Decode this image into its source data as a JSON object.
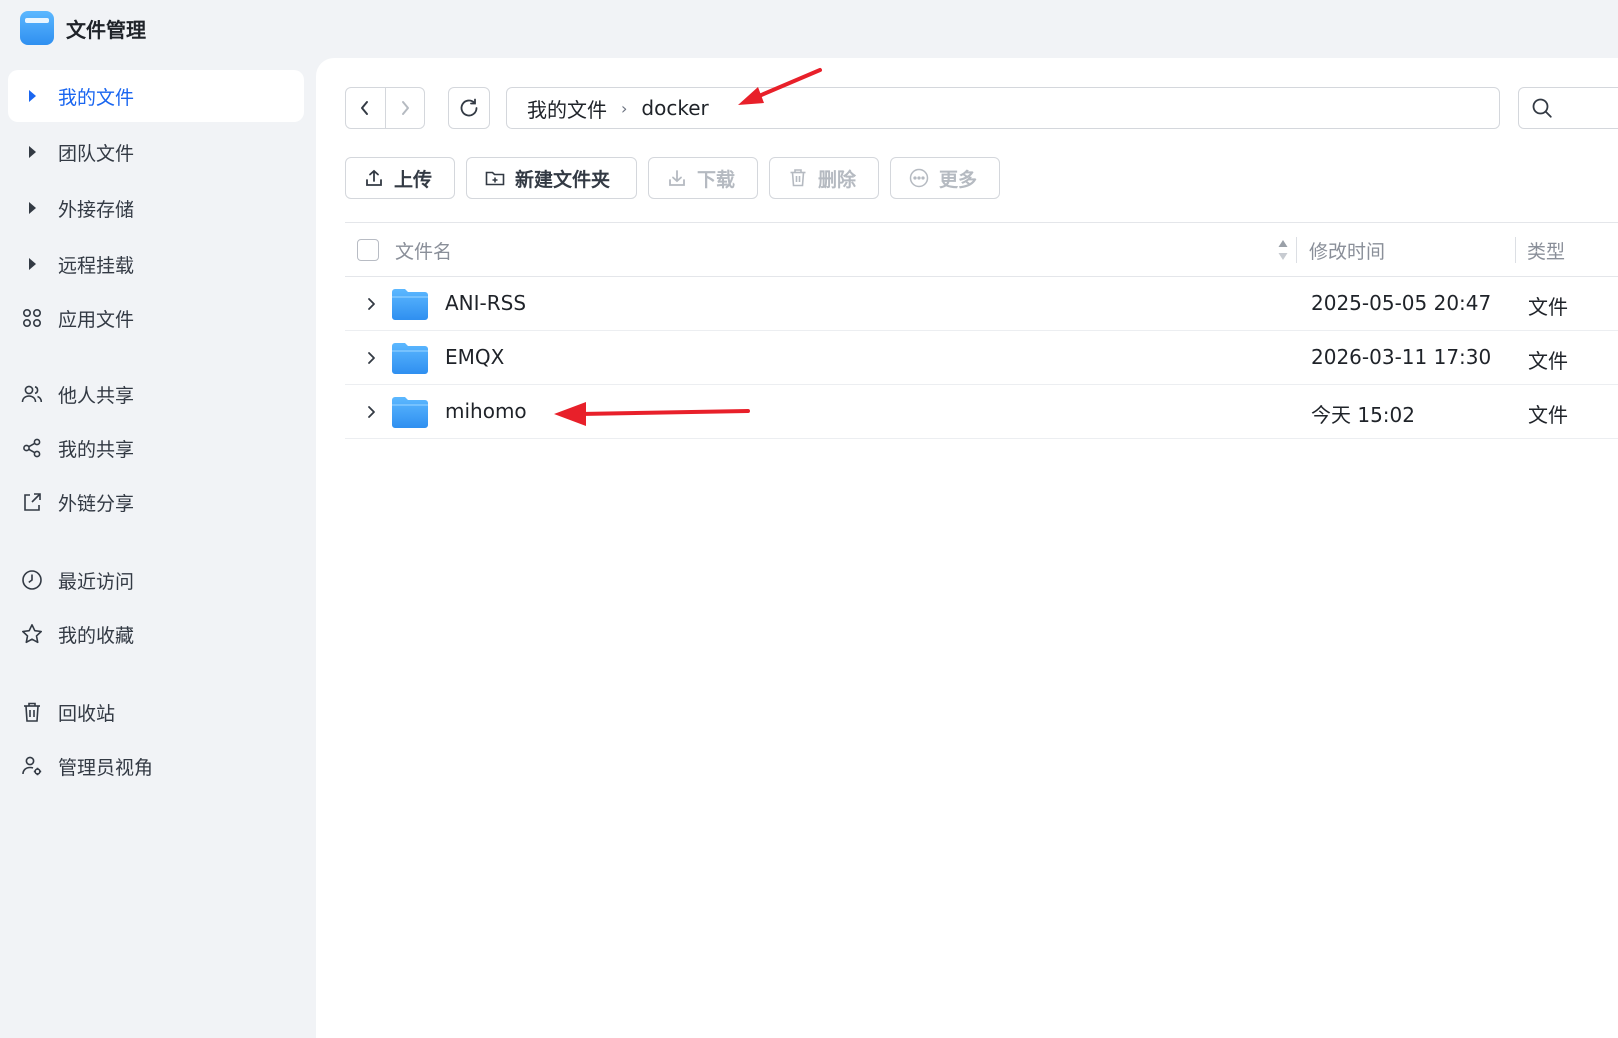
{
  "app": {
    "title": "文件管理"
  },
  "sidebar": {
    "items": [
      {
        "label": "我的文件",
        "icon": "caret-right-icon",
        "active": true
      },
      {
        "label": "团队文件",
        "icon": "caret-right-icon"
      },
      {
        "label": "外接存储",
        "icon": "caret-right-icon"
      },
      {
        "label": "远程挂载",
        "icon": "caret-right-icon"
      },
      {
        "label": "应用文件",
        "icon": "apps-grid-icon"
      },
      {
        "label": "他人共享",
        "icon": "users-icon"
      },
      {
        "label": "我的共享",
        "icon": "share-icon"
      },
      {
        "label": "外链分享",
        "icon": "external-link-icon"
      },
      {
        "label": "最近访问",
        "icon": "clock-icon"
      },
      {
        "label": "我的收藏",
        "icon": "star-icon"
      },
      {
        "label": "回收站",
        "icon": "trash-icon"
      },
      {
        "label": "管理员视角",
        "icon": "admin-user-icon"
      }
    ]
  },
  "breadcrumb": {
    "root": "我的文件",
    "current": "docker"
  },
  "toolbar": {
    "upload": "上传",
    "new_folder": "新建文件夹",
    "download": "下载",
    "delete": "删除",
    "more": "更多"
  },
  "table": {
    "columns": {
      "name": "文件名",
      "modified": "修改时间",
      "type": "类型"
    },
    "rows": [
      {
        "name": "ANI-RSS",
        "modified": "2025-05-05 20:47",
        "type": "文件"
      },
      {
        "name": "EMQX",
        "modified": "2026-03-11 17:30",
        "type": "文件"
      },
      {
        "name": "mihomo",
        "modified": "今天 15:02",
        "type": "文件"
      }
    ]
  },
  "colors": {
    "accent": "#1a66f0",
    "annotation_arrow": "#e8202a",
    "folder": "#2f8ff0"
  }
}
